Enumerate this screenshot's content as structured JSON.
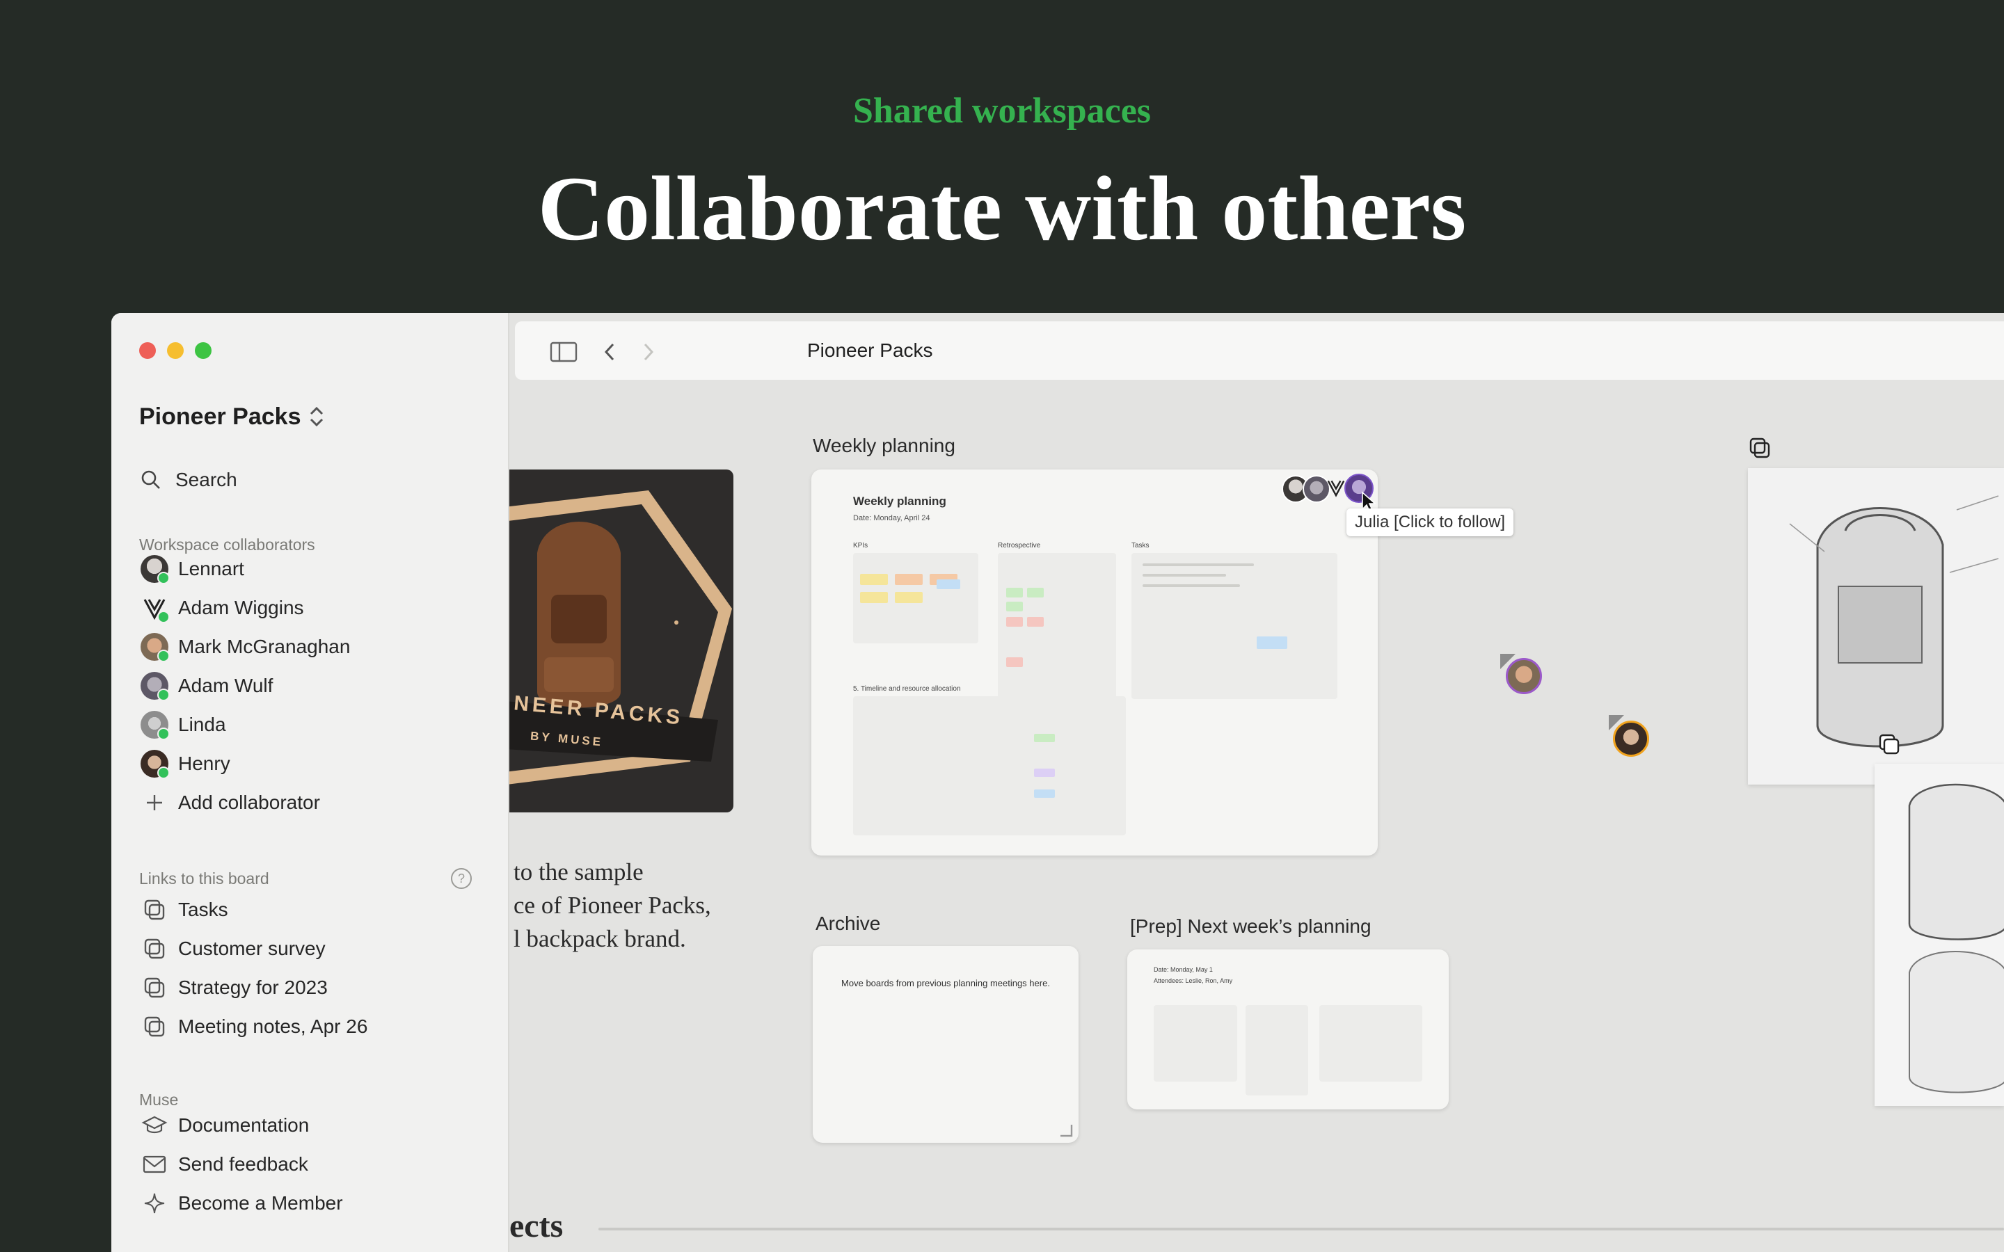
{
  "hero": {
    "eyebrow": "Shared workspaces",
    "title": "Collaborate with others"
  },
  "sidebar": {
    "workspace_name": "Pioneer Packs",
    "search_label": "Search",
    "collaborators_label": "Workspace collaborators",
    "collaborators": [
      {
        "name": "Lennart"
      },
      {
        "name": "Adam Wiggins"
      },
      {
        "name": "Mark McGranaghan"
      },
      {
        "name": "Adam Wulf"
      },
      {
        "name": "Linda"
      },
      {
        "name": "Henry"
      }
    ],
    "add_collaborator": "Add collaborator",
    "links_label": "Links to this board",
    "links": [
      "Tasks",
      "Customer survey",
      "Strategy for 2023",
      "Meeting notes, Apr 26"
    ],
    "muse_label": "Muse",
    "muse_items": [
      "Documentation",
      "Send feedback",
      "Become a Member"
    ]
  },
  "topbar": {
    "breadcrumb": "Pioneer Packs"
  },
  "canvas": {
    "weekly_planning": {
      "label": "Weekly planning",
      "card_title": "Weekly planning",
      "card_date": "Date: Monday, April 24",
      "sections": [
        "KPIs",
        "Retrospective",
        "Tasks"
      ],
      "timeline_label": "5. Timeline and resource allocation"
    },
    "archive": {
      "label": "Archive",
      "note": "Move boards from previous planning meetings here."
    },
    "prep": {
      "label": "[Prep] Next week’s planning",
      "date": "Date: Monday, May 1",
      "attendees": "Attendees: Leslie, Ron, Amy"
    },
    "logo_text": "NEER PACKS",
    "logo_sub": "BY MUSE",
    "intro_lines": [
      "to the sample",
      "ce of Pioneer Packs,",
      "l backpack brand."
    ],
    "tooltip": "Julia [Click to follow]",
    "bottom_section": "ects"
  },
  "colors": {
    "background": "#252b26",
    "accent_green": "#35b24f",
    "online": "#32c15a"
  }
}
